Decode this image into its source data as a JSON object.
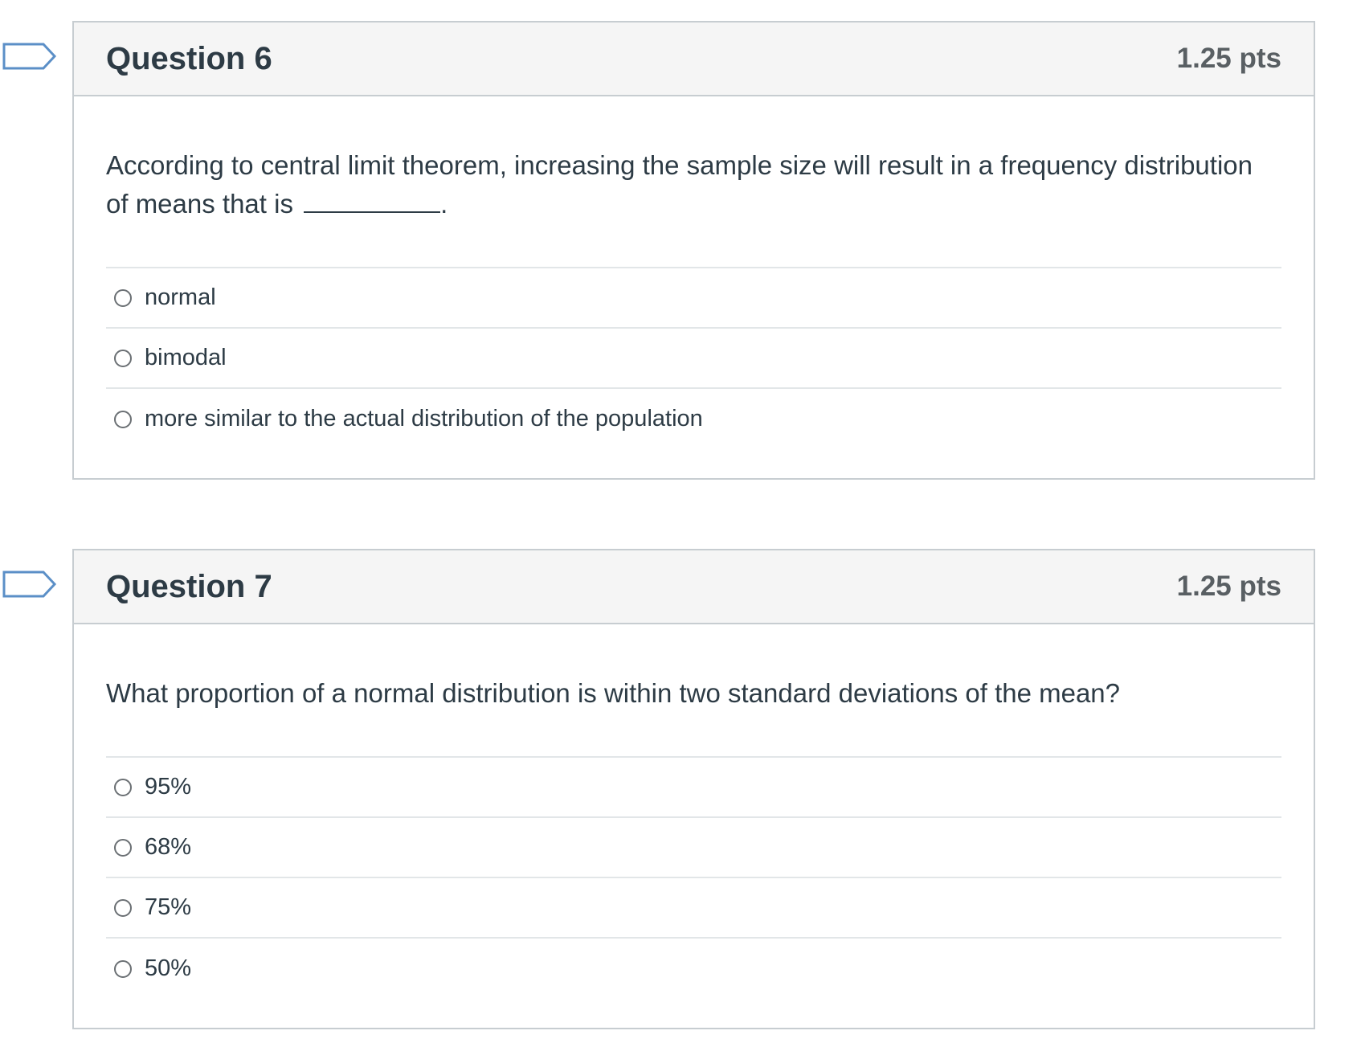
{
  "questions": [
    {
      "title": "Question 6",
      "points": "1.25 pts",
      "prompt_before_blank": "According to central limit theorem, increasing the sample size will result in a frequency distribution of means that is",
      "prompt_after_blank": ".",
      "answers": [
        "normal",
        "bimodal",
        "more similar to the actual distribution of the population"
      ],
      "flag_icon": "bookmark-flag-icon"
    },
    {
      "title": "Question 7",
      "points": "1.25 pts",
      "prompt": "What proportion of a normal distribution is within two standard deviations of the mean?",
      "answers": [
        "95%",
        "68%",
        "75%",
        "50%"
      ],
      "flag_icon": "bookmark-flag-icon"
    }
  ],
  "colors": {
    "flag_outline": "#5b8fc7",
    "header_bg": "#f5f5f5",
    "border": "#c7cdd1",
    "text": "#2d3b45",
    "points_text": "#595f63"
  }
}
